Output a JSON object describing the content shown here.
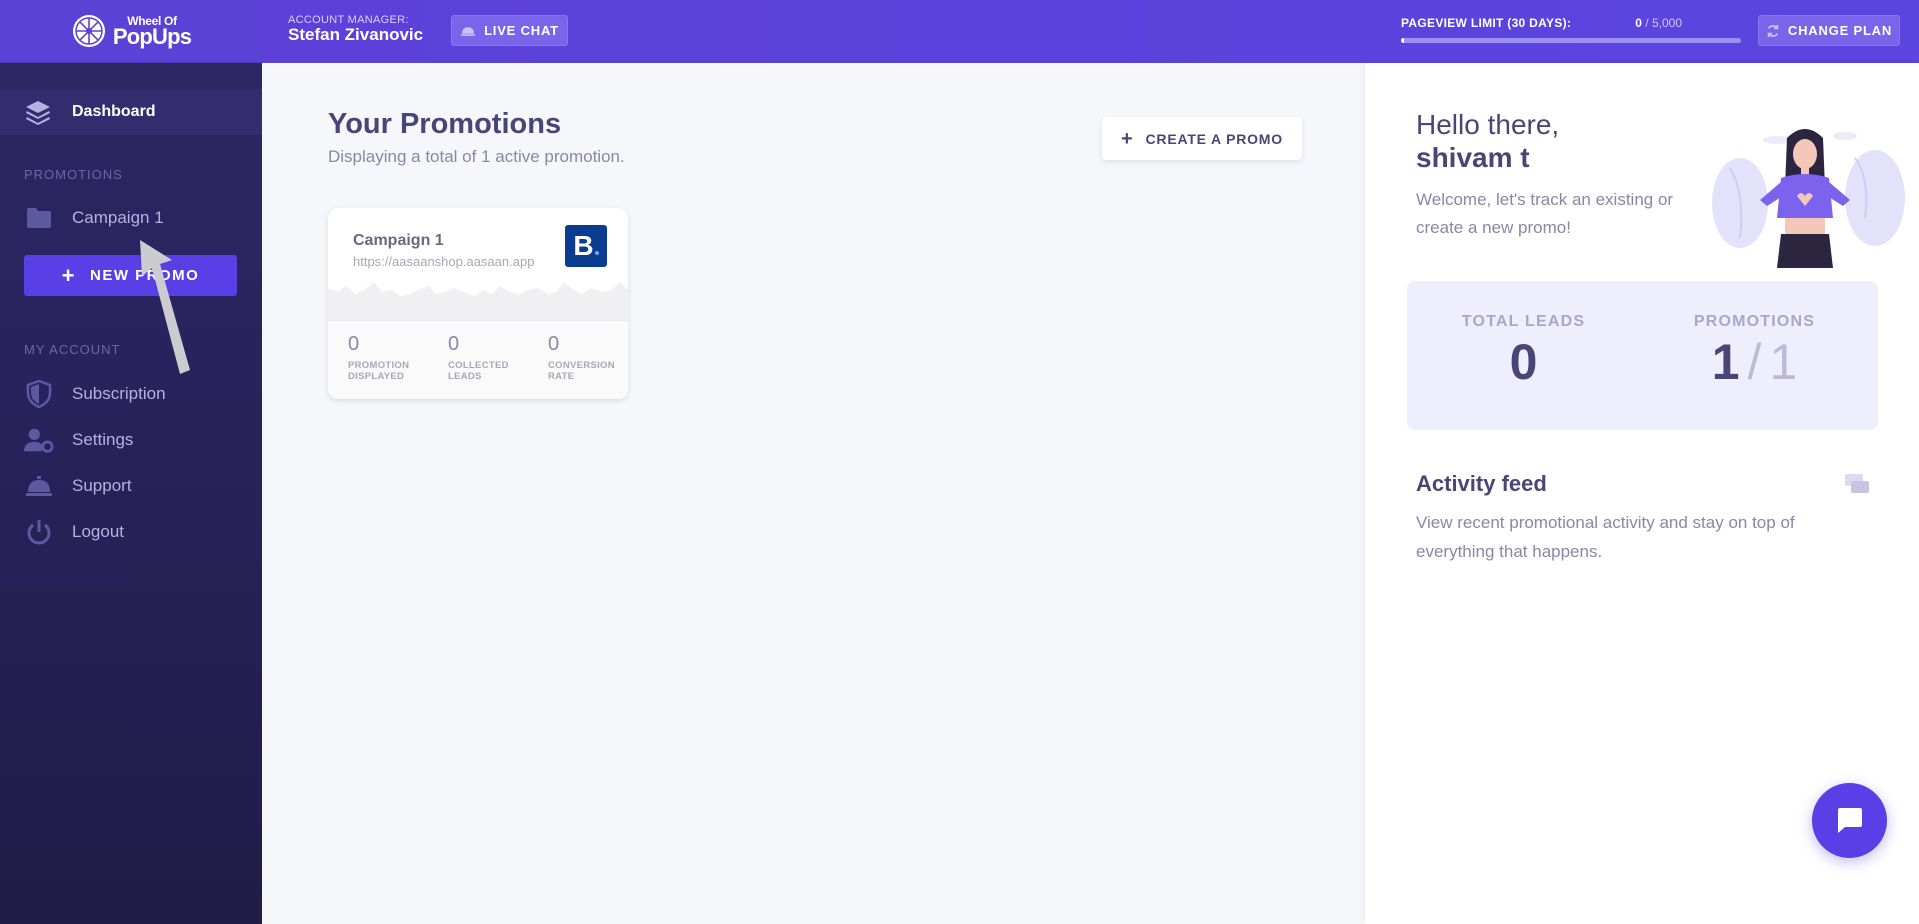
{
  "brand": {
    "line1": "Wheel Of",
    "line2": "PopUps"
  },
  "sidebar": {
    "dashboard_label": "Dashboard",
    "promotions_title": "PROMOTIONS",
    "campaign_item": "Campaign 1",
    "new_promo_label": "NEW PROMO",
    "account_title": "MY ACCOUNT",
    "account_items": [
      "Subscription",
      "Settings",
      "Support",
      "Logout"
    ]
  },
  "topbar": {
    "account_manager_label": "ACCOUNT MANAGER:",
    "account_manager_name": "Stefan Zivanovic",
    "live_chat_label": "LIVE CHAT",
    "pageview_label": "PAGEVIEW LIMIT (30 DAYS):",
    "pageview_used": "0",
    "pageview_limit": "/ 5,000",
    "pageview_fraction": 0.01,
    "change_plan_label": "CHANGE PLAN"
  },
  "main": {
    "title": "Your Promotions",
    "subtitle": "Displaying a total of 1 active promotion.",
    "create_promo_label": "CREATE A PROMO",
    "card": {
      "title": "Campaign 1",
      "url": "https://aasaanshop.aasaan.app",
      "logo_letter": "B",
      "stats": [
        {
          "value": "0",
          "label1": "PROMOTION",
          "label2": "DISPLAYED"
        },
        {
          "value": "0",
          "label1": "COLLECTED",
          "label2": "LEADS"
        },
        {
          "value": "0",
          "label1": "CONVERSION",
          "label2": "RATE"
        }
      ]
    }
  },
  "right": {
    "hello": "Hello there,",
    "user_name": "shivam t",
    "welcome": "Welcome, let's track an existing or create a new promo!",
    "total_leads_label": "TOTAL LEADS",
    "total_leads_value": "0",
    "promotions_label": "PROMOTIONS",
    "promotions_value": "1",
    "promotions_total": "1",
    "activity_title": "Activity feed",
    "activity_desc": "View recent promotional activity and stay on top of everything that happens."
  },
  "colors": {
    "accent": "#5b3fe6",
    "sidebar_bg": "#27225a",
    "topbar_bg": "#5b41d9"
  }
}
